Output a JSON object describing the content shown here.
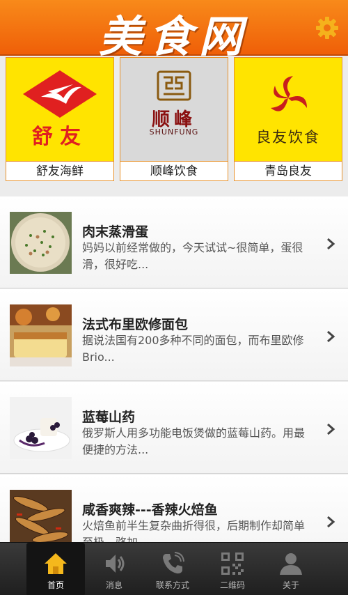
{
  "header": {
    "title": "美食网",
    "settings_icon": "gear-icon"
  },
  "brands": [
    {
      "name": "舒友海鲜",
      "logo_text": "舒友",
      "bg": "#ffe400",
      "accent": "#e02020"
    },
    {
      "name": "顺峰饮食",
      "logo_text": "顺峰",
      "logo_sub": "SHUNFUNG",
      "bg": "#d9d9d9",
      "accent": "#8a1010"
    },
    {
      "name": "青岛良友",
      "logo_text": "良友饮食",
      "bg": "#ffe400",
      "accent": "#c81e1e"
    }
  ],
  "items": [
    {
      "title": "肉末蒸滑蛋",
      "desc": "妈妈以前经常做的，今天试试~很简单，蛋很滑，很好吃..."
    },
    {
      "title": "法式布里欧修面包",
      "desc": "据说法国有200多种不同的面包，而布里欧修Brio..."
    },
    {
      "title": "蓝莓山药",
      "desc": "俄罗斯人用多功能电饭煲做的蓝莓山药。用最便捷的方法..."
    },
    {
      "title": "咸香爽辣---香辣火焙鱼",
      "desc": "火焙鱼前半生复杂曲折得很，后期制作却简单至极。骆加..."
    }
  ],
  "tabbar": {
    "tabs": [
      {
        "label": "首页",
        "icon": "home-icon",
        "active": true
      },
      {
        "label": "消息",
        "icon": "speaker-icon",
        "active": false
      },
      {
        "label": "联系方式",
        "icon": "phone-icon",
        "active": false
      },
      {
        "label": "二维码",
        "icon": "qrcode-icon",
        "active": false
      },
      {
        "label": "关于",
        "icon": "user-icon",
        "active": false
      }
    ]
  },
  "colors": {
    "header_orange": "#f07210",
    "brand_border": "#e8922c",
    "tabbar_dark": "#2a2a2a",
    "home_icon_yellow": "#f5b81c"
  }
}
